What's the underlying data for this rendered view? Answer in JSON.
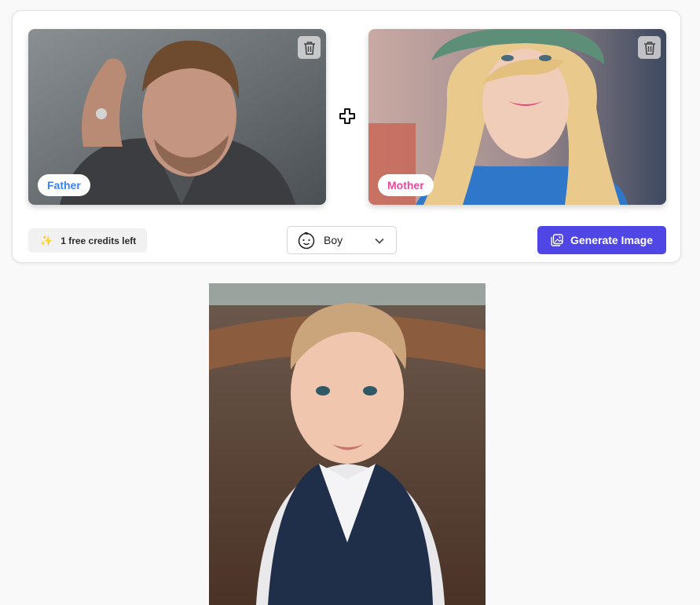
{
  "parents": {
    "father": {
      "label": "Father",
      "delete_icon": "trash-icon"
    },
    "mother": {
      "label": "Mother",
      "delete_icon": "trash-icon"
    },
    "join_icon": "plus-icon"
  },
  "controls": {
    "credits_text": "1 free credits left",
    "credits_icon": "sparkle-icon",
    "gender_selected": "Boy",
    "gender_icon": "baby-face-icon",
    "generate_label": "Generate Image",
    "generate_icon": "image-gallery-icon"
  },
  "colors": {
    "accent": "#5046e5",
    "father_label": "#3b82f6",
    "mother_label": "#ec4899"
  }
}
